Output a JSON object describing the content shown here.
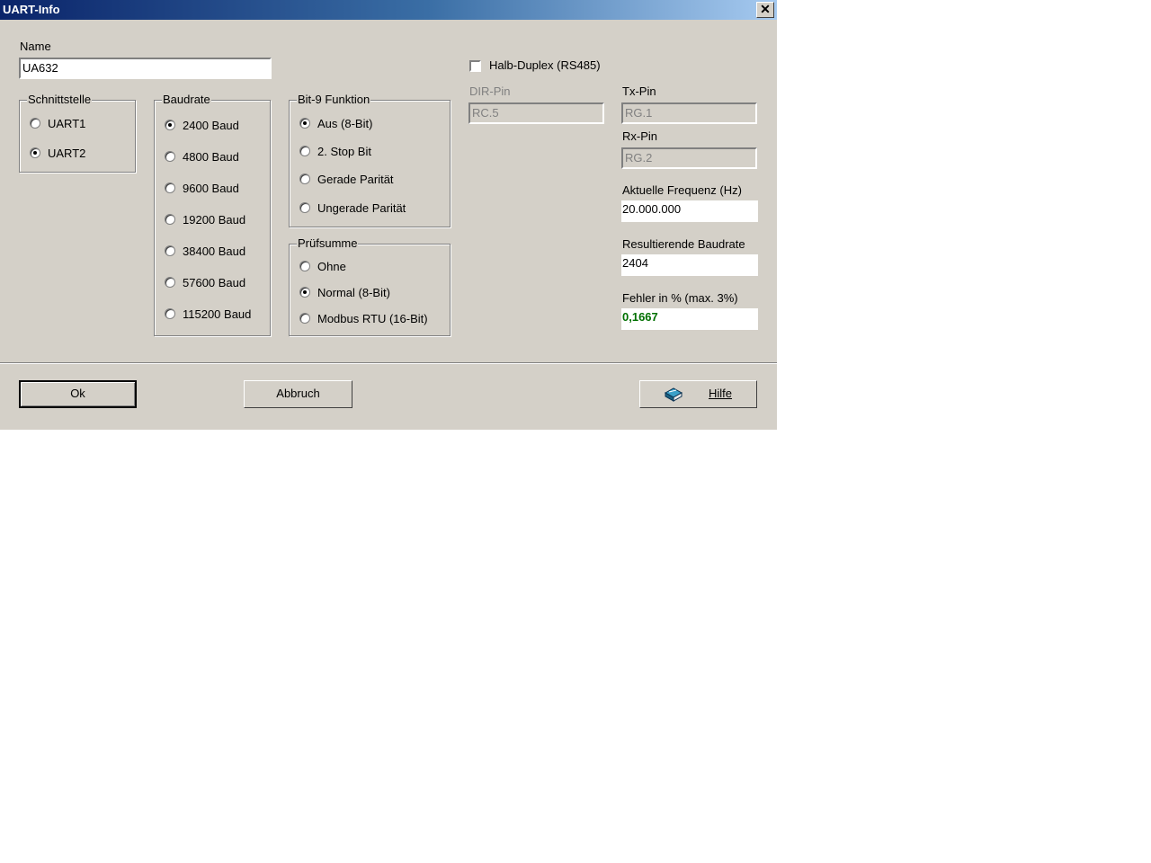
{
  "window": {
    "title": "UART-Info",
    "close_glyph": "✕"
  },
  "name": {
    "label": "Name",
    "value": "UA632"
  },
  "interface": {
    "legend": "Schnittstelle",
    "options": [
      "UART1",
      "UART2"
    ],
    "selected": "UART2"
  },
  "baudrate": {
    "legend": "Baudrate",
    "options": [
      "2400 Baud",
      "4800 Baud",
      "9600 Baud",
      "19200 Baud",
      "38400 Baud",
      "57600 Baud",
      "115200 Baud"
    ],
    "selected": "2400 Baud"
  },
  "bit9": {
    "legend": "Bit-9 Funktion",
    "options": [
      "Aus (8-Bit)",
      "2. Stop Bit",
      "Gerade Parität",
      "Ungerade Parität"
    ],
    "selected": "Aus (8-Bit)"
  },
  "checksum": {
    "legend": "Prüfsumme",
    "options": [
      "Ohne",
      "Normal (8-Bit)",
      "Modbus RTU (16-Bit)"
    ],
    "selected": "Normal (8-Bit)"
  },
  "half_duplex": {
    "label": "Halb-Duplex (RS485)",
    "checked": false
  },
  "dir_pin": {
    "label": "DIR-Pin",
    "value": "RC.5"
  },
  "tx_pin": {
    "label": "Tx-Pin",
    "value": "RG.1"
  },
  "rx_pin": {
    "label": "Rx-Pin",
    "value": "RG.2"
  },
  "frequency": {
    "label": "Aktuelle Frequenz (Hz)",
    "value": "20.000.000"
  },
  "result_baud": {
    "label": "Resultierende Baudrate",
    "value": "2404"
  },
  "error": {
    "label": "Fehler in % (max. 3%)",
    "value": "0,1667",
    "color": "#007000"
  },
  "buttons": {
    "ok": "Ok",
    "cancel": "Abbruch",
    "help": "Hilfe"
  },
  "icons": {
    "help": "help-book-icon"
  }
}
